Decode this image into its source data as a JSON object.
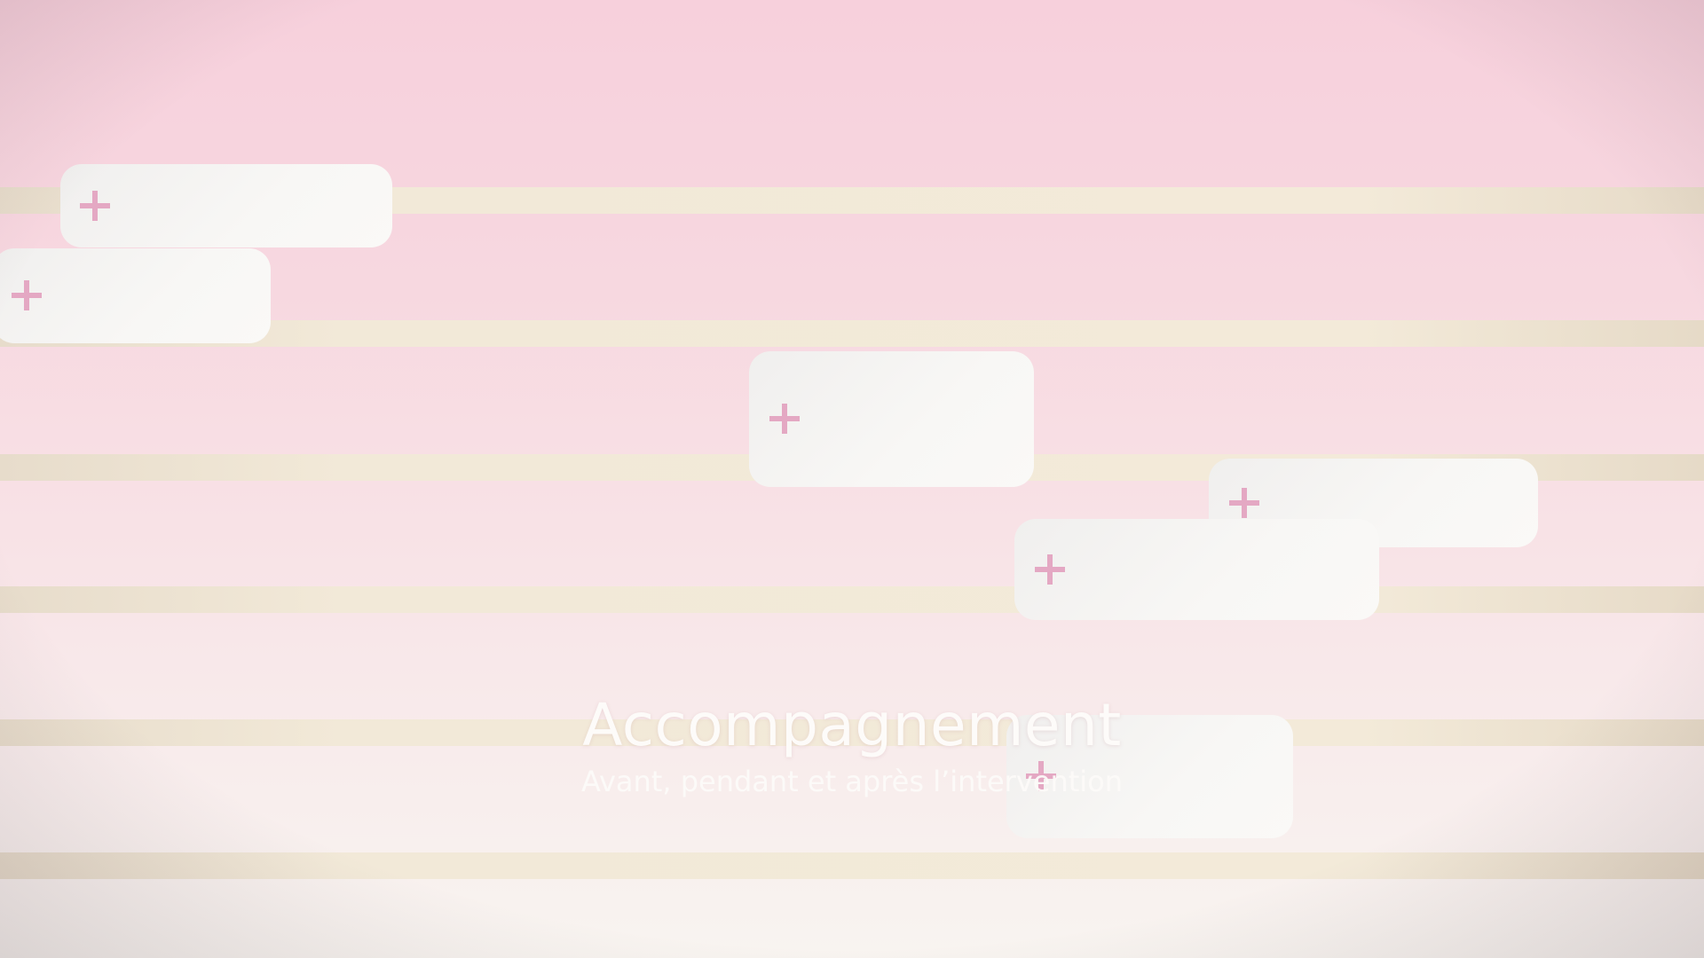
{
  "slide": {
    "title": "Accompagnement",
    "subtitle": "Avant, pendant et après l’intervention"
  },
  "icons": {
    "expand": "plus-icon"
  },
  "colors": {
    "background_top": "#f7d0dc",
    "background_bottom": "#f8f4f0",
    "stripe": "#f2e9d8",
    "card": "#faf9f7",
    "accent": "#e4a8c3",
    "title_text": "#fdfbf9"
  }
}
